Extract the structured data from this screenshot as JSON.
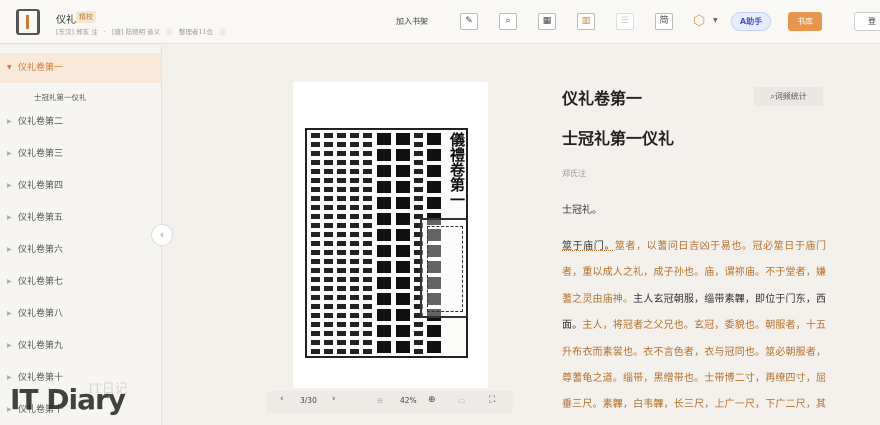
{
  "header": {
    "title": "仪礼",
    "badge": "精校",
    "meta_author1": "[东汉] 郑玄 注",
    "meta_sep": "·",
    "meta_author2": "[唐] 陆德明 音义",
    "meta_editor": "整理者11位",
    "add_to_shelf": "加入书架",
    "tools": [
      "pen-icon",
      "search-icon",
      "image-icon",
      "columns-icon",
      "list-icon",
      "simplified-icon"
    ],
    "simplified_label": "简",
    "ai_label": "A助手",
    "library_label": "书库",
    "login_label": "登"
  },
  "sidebar": {
    "items": [
      {
        "label": "仪礼卷第一",
        "expanded": true,
        "active": true
      },
      {
        "label": "仪礼卷第二"
      },
      {
        "label": "仪礼卷第三"
      },
      {
        "label": "仪礼卷第四"
      },
      {
        "label": "仪礼卷第五"
      },
      {
        "label": "仪礼卷第六"
      },
      {
        "label": "仪礼卷第七"
      },
      {
        "label": "仪礼卷第八"
      },
      {
        "label": "仪礼卷第九"
      },
      {
        "label": "仪礼卷第十"
      },
      {
        "label": "仪礼卷第十"
      }
    ],
    "sub_item": "士冠礼第一仪礼"
  },
  "scan": {
    "title_text": "儀禮卷第一"
  },
  "pager": {
    "page": "3/30",
    "zoom": "42%"
  },
  "reader": {
    "volume_title": "仪礼卷第一",
    "word_stats": "词频统计",
    "chapter_title": "士冠礼第一仪礼",
    "author": "郑氏注",
    "first_para": "士冠礼。",
    "body_segments": [
      {
        "t": "筮于庙门。",
        "c": false
      },
      {
        "t": "筮者，以蓍问日吉凶于易也。冠必筮日于庙门者，重以成人之礼，成子孙也。庙，谓祢庙。不于堂者，嫌蓍之灵由庙神。",
        "c": true
      },
      {
        "t": "主人玄冠朝服，缁带素韠，即位于门东，西面。",
        "c": false
      },
      {
        "t": "主人，将冠者之父兄也。玄冠，委貌也。朝服者，十五升布衣而素裳也。衣不言色者，衣与冠同也。筮必朝服者，尊蓍龟之道。缁带，黑缯带也。士带博二寸，再缭四寸，屈垂三尺。素韠，白韦韠，长三尺，上广一尺，下广二尺，其颈五寸，肩，革带博二寸。天子与其",
        "c": true
      }
    ]
  },
  "watermark": {
    "brand": "IT Diary",
    "cn": "IT日记"
  }
}
